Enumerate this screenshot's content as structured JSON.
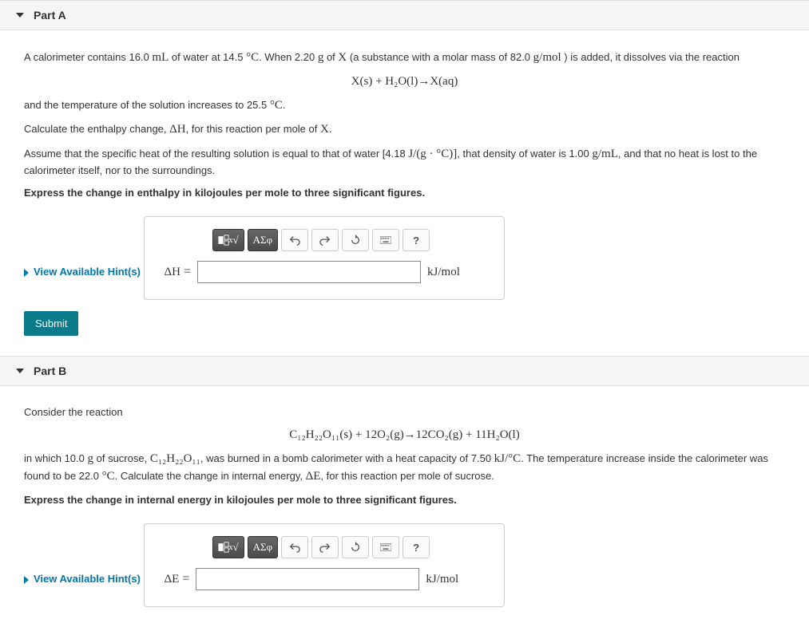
{
  "partA": {
    "title": "Part A",
    "p1_a": "A calorimeter contains 16.0 ",
    "p1_b": "mL",
    "p1_c": " of water at 14.5 ",
    "p1_d": "°C",
    "p1_e": ". When 2.20 ",
    "p1_f": "g",
    "p1_g": " of ",
    "p1_h": "X",
    "p1_i": " (a substance with a molar mass of 82.0 ",
    "p1_j": "g/mol",
    "p1_k": " ) is added, it dissolves via the reaction",
    "eq1": "X(s) + H₂O(l)→X(aq)",
    "p2_a": "and the temperature of the solution increases to 25.5 ",
    "p2_b": "°C",
    "p2_c": ".",
    "p3_a": "Calculate the enthalpy change, ",
    "p3_b": "ΔH",
    "p3_c": ", for this reaction per mole of ",
    "p3_d": "X",
    "p3_e": ".",
    "p4_a": "Assume that the specific heat of the resulting solution is equal to that of water [4.18 ",
    "p4_b": "J/(g · °C)]",
    "p4_c": ", that density of water is 1.00 ",
    "p4_d": "g/mL",
    "p4_e": ", and that no heat is lost to the calorimeter itself, nor to the surroundings.",
    "p5": "Express the change in enthalpy in kilojoules per mole to three significant figures.",
    "hints": "View Available Hint(s)",
    "var": "ΔH",
    "unit": "kJ/mol",
    "submit": "Submit"
  },
  "partB": {
    "title": "Part B",
    "p1": "Consider the reaction",
    "eq1": "C₁₂H₂₂O₁₁(s) + 12O₂(g)→12CO₂(g) + 11H₂O(l)",
    "p2_a": "in which 10.0 ",
    "p2_b": "g",
    "p2_c": " of sucrose, ",
    "p2_d": "C₁₂H₂₂O₁₁",
    "p2_e": ", was burned in a bomb calorimeter with a heat capacity of 7.50 ",
    "p2_f": "kJ/°C",
    "p2_g": ". The temperature increase inside the calorimeter was found to be 22.0 ",
    "p2_h": "°C",
    "p2_i": ". Calculate the change in internal energy, ",
    "p2_j": "ΔE",
    "p2_k": ", for this reaction per mole of sucrose.",
    "p3": "Express the change in internal energy in kilojoules per mole to three significant figures.",
    "hints": "View Available Hint(s)",
    "var": "ΔE",
    "unit": "kJ/mol"
  },
  "toolbar": {
    "sqrt": "√",
    "greek": "ΑΣφ",
    "help": "?"
  }
}
